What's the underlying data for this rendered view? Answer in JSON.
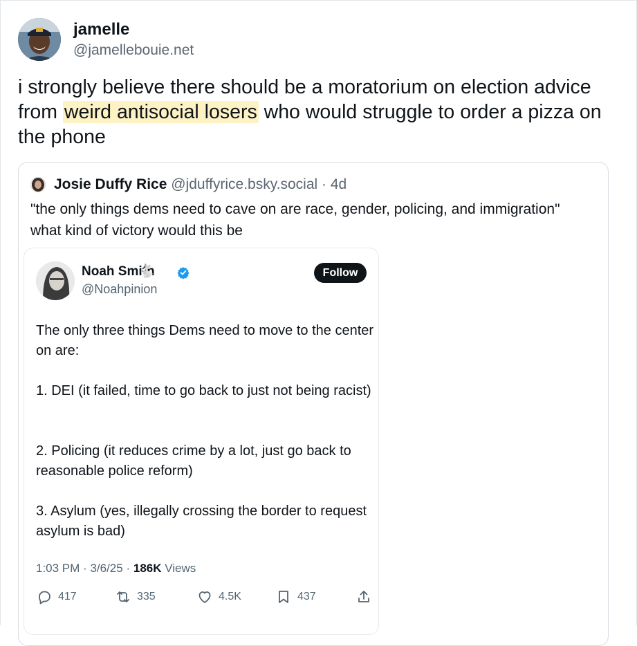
{
  "post": {
    "author_name": "jamelle",
    "author_handle": "@jamellebouie.net",
    "text_before": "i strongly believe there should be a moratorium on election advice from ",
    "text_highlight": "weird antisocial losers",
    "text_after": " who would struggle to order a pizza on the phone"
  },
  "quote": {
    "author_name": "Josie Duffy Rice",
    "author_handle": "@jduffyrice.bsky.social",
    "separator": "·",
    "age": "4d",
    "text": "\"the only things dems need to cave on are race, gender, policing, and immigration\" what kind of victory would this be"
  },
  "embed": {
    "author_name": "Noah Smith",
    "author_emoji": "🐇",
    "author_handle": "@Noahpinion",
    "follow_label": "Follow",
    "paragraphs": [
      "The only three things Dems need to move to the center on are:",
      "1. DEI (it failed, time to go back to just not being racist)",
      "2. Policing (it reduces crime by a lot, just go back to reasonable police reform)",
      "3. Asylum (yes, illegally crossing the border to request asylum is bad)"
    ],
    "time": "1:03 PM",
    "date": "3/6/25",
    "meta_sep": "·",
    "views_count": "186K",
    "views_label": "Views",
    "replies": "417",
    "reposts": "335",
    "likes": "4.5K",
    "bookmarks": "437"
  },
  "colors": {
    "highlight": "#fdf2c4",
    "verified": "#1d9bf0",
    "text": "#0f1419",
    "muted": "#536471"
  },
  "icons": [
    "reply-icon",
    "repost-icon",
    "like-icon",
    "bookmark-icon",
    "share-icon",
    "verified-badge-icon"
  ]
}
